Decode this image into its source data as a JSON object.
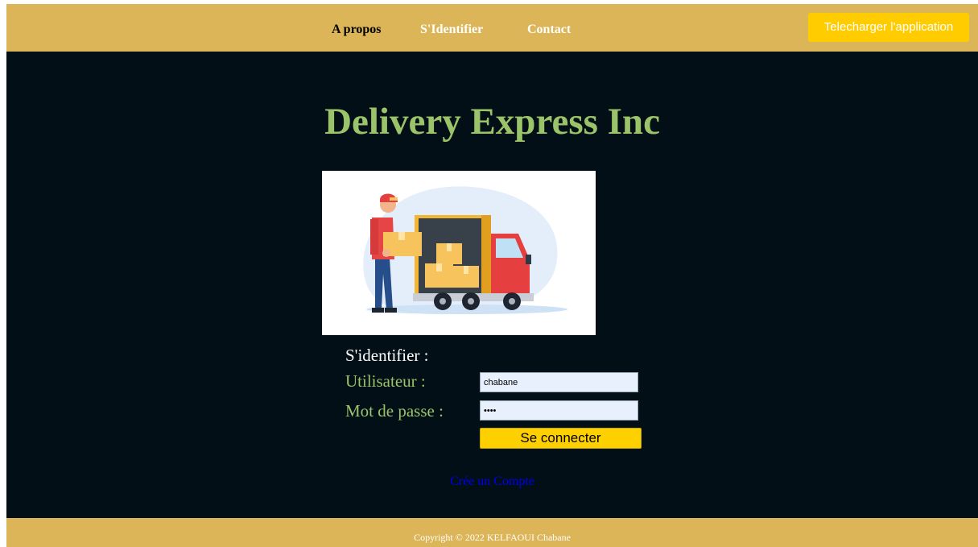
{
  "colors": {
    "bar_gold": "#dbb557",
    "page_dark": "#020f16",
    "title_green": "#9bc46a",
    "button_yellow": "#ffcc00",
    "link_blue": "#0000ee"
  },
  "nav": {
    "about": "A propos",
    "login": "S'Identifier",
    "contact": "Contact",
    "download_button": "Telecharger l'application"
  },
  "main": {
    "title": "Delivery Express Inc",
    "hero_image": "delivery-truck-illustration"
  },
  "login_form": {
    "heading": "S'identifier :",
    "username_label": "Utilisateur :",
    "username_value": "chabane",
    "password_label": "Mot de passe :",
    "password_value": "••••",
    "submit_label": "Se connecter"
  },
  "links": {
    "create_account": "Crée un Compte"
  },
  "footer": {
    "copyright": "Copyright © 2022 KELFAOUI Chabane"
  }
}
